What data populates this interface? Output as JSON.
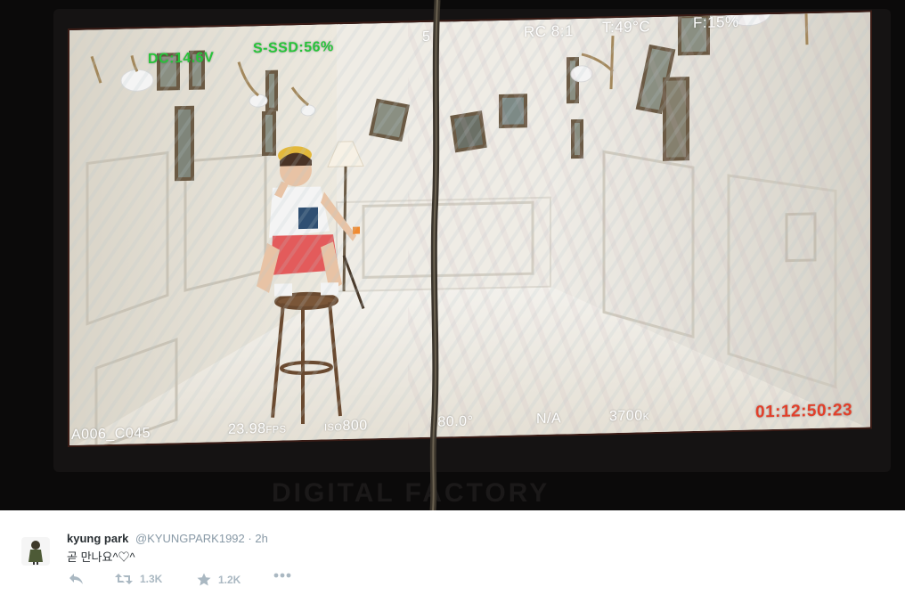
{
  "monitor": {
    "osd_top": {
      "dc": "DC:14.6V",
      "ssd": "S-SSD:56%",
      "five": "5",
      "rc": "RC 8:1",
      "temp": "T:49°C",
      "fan": "F:15%"
    },
    "osd_bottom": {
      "clip": "A006_C045",
      "fps": "23.98",
      "fps_unit": "FPS",
      "iso_unit": "ISO",
      "iso": "800",
      "shutter": "180.0°",
      "na": "N/A",
      "wb": "3700",
      "wb_unit": "K",
      "timecode": "01:12:50:23"
    },
    "brand": "DIGITAL FACTORY",
    "colors": {
      "osd_green": "#27c43a",
      "osd_red": "#e2402b",
      "rec": "#e5412a"
    }
  },
  "tweet": {
    "name": "kyung park",
    "handle": "@KYUNGPARK1992",
    "separator": "·",
    "time": "2h",
    "text": "곧 만나요^♡^",
    "actions": [
      {
        "icon": "reply-icon",
        "count": ""
      },
      {
        "icon": "retweet-icon",
        "count": "1.3K"
      },
      {
        "icon": "star-icon",
        "count": "1.2K"
      },
      {
        "icon": "more-icon",
        "count": ""
      }
    ]
  }
}
